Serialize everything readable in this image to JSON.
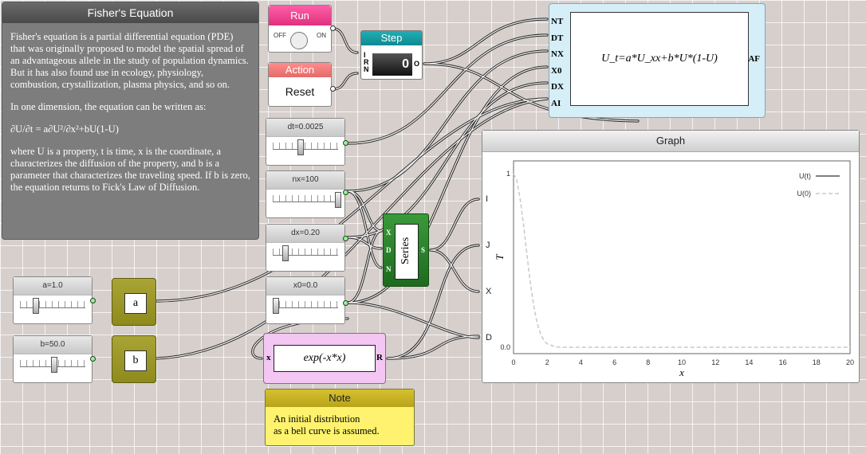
{
  "description": {
    "title": "Fisher's Equation",
    "p1": "Fisher's equation is a partial differential equation (PDE) that was originally proposed to model the spatial spread of an advantageous allele in the study of population dynamics. But it has also found use in ecology, physiology, combustion, crystallization, plasma physics, and so on.",
    "p2": "In one dimension, the equation can be written as:",
    "p3": "∂U/∂t = a∂U²/∂x²+bU(1-U)",
    "p4": "where U is a property, t is time, x is the coordinate, a characterizes the diffusion of the property, and b is a parameter that characterizes the traveling speed. If b is zero, the equation returns to Fick's Law of Diffusion."
  },
  "run": {
    "title": "Run",
    "off": "OFF",
    "on": "ON"
  },
  "action": {
    "title": "Action",
    "label": "Reset"
  },
  "step": {
    "title": "Step",
    "value": "0",
    "pins": [
      "I",
      "R",
      "N"
    ],
    "out": "O"
  },
  "sliders": {
    "dt": {
      "label": "dt=0.0025",
      "value": 0.4
    },
    "nx": {
      "label": "nx=100",
      "value": 1.0
    },
    "dx": {
      "label": "dx=0.20",
      "value": 0.15
    },
    "x0": {
      "label": "x0=0.0",
      "value": 0.0
    },
    "a": {
      "label": "a=1.0",
      "value": 0.2
    },
    "b": {
      "label": "b=50.0",
      "value": 0.5
    }
  },
  "params": {
    "a": "a",
    "b": "b"
  },
  "series": {
    "label": "Series",
    "pins": [
      "X",
      "D",
      "N"
    ],
    "out": "S"
  },
  "expression": {
    "text": "exp(-x*x)",
    "in": "x",
    "out": "R"
  },
  "note": {
    "title": "Note",
    "line1": "An initial distribution",
    "line2": "as a bell curve is assumed."
  },
  "equation": {
    "text": "U_t=a*U_xx+b*U*(1-U)",
    "pins": [
      "NT",
      "DT",
      "NX",
      "X0",
      "DX",
      "AI"
    ],
    "out": "AF"
  },
  "graph": {
    "title": "Graph",
    "pins": [
      "I",
      "J",
      "X",
      "D"
    ]
  },
  "chart_data": {
    "type": "line",
    "xlabel": "x",
    "ylabel": "T",
    "xlim": [
      0,
      20
    ],
    "ylim": [
      0,
      1
    ],
    "xticks": [
      0,
      2,
      4,
      6,
      8,
      10,
      12,
      14,
      16,
      18,
      20
    ],
    "yticks": [
      {
        "v": 0,
        "t": "0.0"
      },
      {
        "v": 1,
        "t": "1"
      }
    ],
    "legend_position": "top-right",
    "series": [
      {
        "name": "U(t)",
        "style": "solid",
        "color": "#555555",
        "x": [],
        "y": []
      },
      {
        "name": "U(0)",
        "style": "dashed",
        "color": "#c8c8c8",
        "x": [
          0,
          0.2,
          0.4,
          0.6,
          0.8,
          1.0,
          1.2,
          1.4,
          1.6,
          1.8,
          2.0,
          2.5,
          3,
          4,
          6,
          8,
          10,
          12,
          14,
          16,
          18,
          20
        ],
        "y": [
          1,
          0.96,
          0.85,
          0.7,
          0.53,
          0.37,
          0.24,
          0.14,
          0.08,
          0.04,
          0.02,
          0.002,
          0,
          0,
          0,
          0,
          0,
          0,
          0,
          0,
          0,
          0
        ]
      }
    ]
  }
}
